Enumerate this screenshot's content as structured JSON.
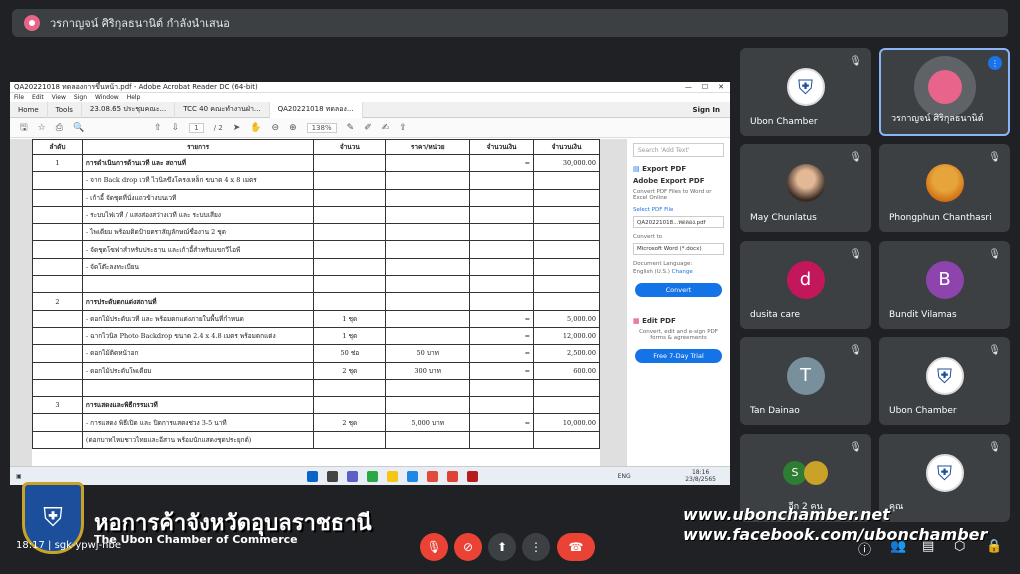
{
  "presenter": {
    "text": "วรกาญจน์ ศิริกุลธนานิต์ กำลังนำเสนอ"
  },
  "acrobat": {
    "window_title": "QA20221018 ทดลองการขึ้นหน้า.pdf - Adobe Acrobat Reader DC (64-bit)",
    "menu": [
      "File",
      "Edit",
      "View",
      "Sign",
      "Window",
      "Help"
    ],
    "tabs": [
      "Home",
      "Tools",
      "23.08.65 ประชุมคณะ...",
      "TCC 40 คณะทำงานฝ่า...",
      "QA20221018 ทดลอง..."
    ],
    "sign_in": "Sign In",
    "page_current": "1",
    "page_total": "/ 2",
    "zoom": "138%"
  },
  "table": {
    "headers": [
      "ลำดับ",
      "รายการ",
      "จำนวน",
      "ราคา/หน่วย",
      "จำนวนเงิน",
      "จำนวนเงิน"
    ],
    "rows": [
      [
        "1",
        "การดำเนินการด้านเวที และ สถานที่",
        "",
        "",
        "=",
        "30,000.00"
      ],
      [
        "",
        "- จาก Back drop เวที ไวนิลขึงโครงเหล็ก ขนาด 4 x 8 เมตร",
        "",
        "",
        "",
        ""
      ],
      [
        "",
        "- เก้าอี้ จัดชุดที่นั่งแถวข้างบนเวที",
        "",
        "",
        "",
        ""
      ],
      [
        "",
        "- ระบบไฟเวที / แสงส่องสว่างเวที และ ระบบเสียง",
        "",
        "",
        "",
        ""
      ],
      [
        "",
        "- ไพเดียม พร้อมติดป้ายตราสัญลักษณ์ชื่องาน 2 ชุด",
        "",
        "",
        "",
        ""
      ],
      [
        "",
        "- จัดชุดโซฟาสำหรับประธาน และเก้าอี้สำหรับแขกวีไอพี",
        "",
        "",
        "",
        ""
      ],
      [
        "",
        "- จัดโต๊ะลงทะเบียน",
        "",
        "",
        "",
        ""
      ],
      [
        "",
        "",
        "",
        "",
        "",
        ""
      ],
      [
        "2",
        "การประดับตกแต่งสถานที่",
        "",
        "",
        "",
        ""
      ],
      [
        "",
        "- ดอกไม้ประดับเวที และ พร้อมตกแต่งภายในพื้นที่กำหนด",
        "1 ชุด",
        "",
        "=",
        "5,000.00"
      ],
      [
        "",
        "- ฉากไวนิล Photo Backdrop ขนาด 2.4 x 4.8 เมตร พร้อมตกแต่ง",
        "1 ชุด",
        "",
        "=",
        "12,000.00"
      ],
      [
        "",
        "- ดอกไม้ติดหน้าอก",
        "50 ช่อ",
        "50 บาท",
        "=",
        "2,500.00"
      ],
      [
        "",
        "- ดอกไม้ประดับโพเดียม",
        "2 ชุด",
        "300 บาท",
        "=",
        "600.00"
      ],
      [
        "",
        "",
        "",
        "",
        "",
        ""
      ],
      [
        "3",
        "การแสดงและพิธีกรรมเวที",
        "",
        "",
        "",
        ""
      ],
      [
        "",
        "- การแสดง พิธีเปิด และ ปิดการแสดงช่วง 3-5 นาที",
        "2 ชุด",
        "5,000 บาท",
        "=",
        "10,000.00"
      ],
      [
        "",
        "(ดอกบาทไหมชาวไทยและอีสาน พร้อมนักแสดงชุดประยุกต์)",
        "",
        "",
        "",
        ""
      ]
    ]
  },
  "right_panel": {
    "search": "Search 'Add Text'",
    "export_title": "Export PDF",
    "adobe_export": "Adobe Export PDF",
    "adobe_export_desc": "Convert PDF Files to Word or Excel Online",
    "select_pdf": "Select PDF File",
    "file_name": "QA20221018...ทดลอง.pdf",
    "convert_to": "Convert to",
    "format": "Microsoft Word (*.docx)",
    "doc_lang": "Document Language:",
    "lang_value": "English (U.S.)",
    "change": "Change",
    "convert_btn": "Convert",
    "edit_pdf": "Edit PDF",
    "edit_desc": "Convert, edit and e-sign PDF forms & agreements",
    "trial_btn": "Free 7-Day Trial"
  },
  "taskbar": {
    "lang": "ENG",
    "time": "18:16",
    "date": "23/8/2565"
  },
  "participants": [
    {
      "name": "Ubon Chamber",
      "type": "logo"
    },
    {
      "name": "วรกาญจน์ ศิริกุลธนานิต์",
      "type": "user"
    },
    {
      "name": "May Chunlatus",
      "type": "photo-f"
    },
    {
      "name": "Phongphun Chanthasri",
      "type": "photo-m"
    },
    {
      "name": "dusita care",
      "type": "letter",
      "letter": "d",
      "color": "#c2185b"
    },
    {
      "name": "Bundit Vilamas",
      "type": "letter",
      "letter": "B",
      "color": "#8e44ad"
    },
    {
      "name": "Tan Dainao",
      "type": "letter",
      "letter": "T",
      "color": "#78909c"
    },
    {
      "name": "Ubon Chamber",
      "type": "logo"
    },
    {
      "name": "อีก 2 คน",
      "type": "others"
    },
    {
      "name": "คุณ",
      "type": "logo"
    }
  ],
  "overlay": {
    "org_thai": "หอการค้าจังหวัดอุบลราชธานี",
    "org_en": "The Ubon Chamber of Commerce",
    "website": "www.ubonchamber.net",
    "facebook": "www.facebook.com/ubonchamber"
  },
  "meeting": {
    "time": "18:17",
    "code": "sgk-ypwj-hbe"
  }
}
